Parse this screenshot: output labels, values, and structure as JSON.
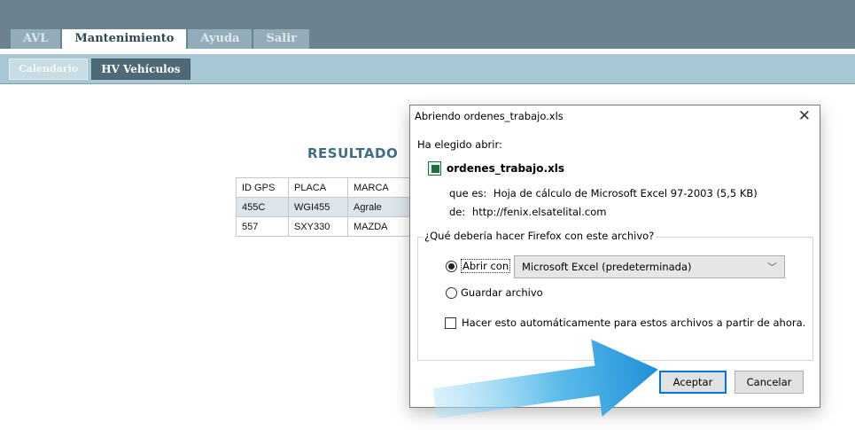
{
  "nav": {
    "tabs": [
      {
        "label": "AVL"
      },
      {
        "label": "Mantenimiento"
      },
      {
        "label": "Ayuda"
      },
      {
        "label": "Salir"
      }
    ],
    "subtabs": [
      {
        "label": "Calendario"
      },
      {
        "label": "HV Vehículos"
      }
    ]
  },
  "results": {
    "title": "RESULTADO",
    "headers": [
      "ID GPS",
      "PLACA",
      "MARCA"
    ],
    "rows": [
      [
        "455C",
        "WGI455",
        "Agrale"
      ],
      [
        "557",
        "SXY330",
        "MAZDA"
      ]
    ]
  },
  "dialog": {
    "title": "Abriendo ordenes_trabajo.xls",
    "close_glyph": "✕",
    "chosen_label": "Ha elegido abrir:",
    "file_name": "ordenes_trabajo.xls",
    "type_label": "que es:",
    "type_value": "Hoja de cálculo de Microsoft Excel 97-2003 (5,5 KB)",
    "from_label": "de:",
    "from_value": "http://fenix.elsatelital.com",
    "question": "¿Qué debería hacer Firefox con este archivo?",
    "open_with_label": "Abrir con",
    "open_with_selected": true,
    "app_select_value": "Microsoft Excel (predeterminada)",
    "save_label": "Guardar archivo",
    "save_selected": false,
    "auto_label": "Hacer esto automáticamente para estos archivos a partir de ahora.",
    "auto_checked": false,
    "ok_button": "Aceptar",
    "cancel_button": "Cancelar"
  },
  "colors": {
    "nav_bar": "#6c838f",
    "sub_bar": "#a9c8d6",
    "accent_arrow": "#2f9fe0",
    "title_text": "#3e6e84"
  },
  "icons": {
    "file_icon": "excel-file-icon",
    "close_icon": "close-icon",
    "chevron": "chevron-down-icon",
    "arrow": "pointer-arrow-icon"
  }
}
